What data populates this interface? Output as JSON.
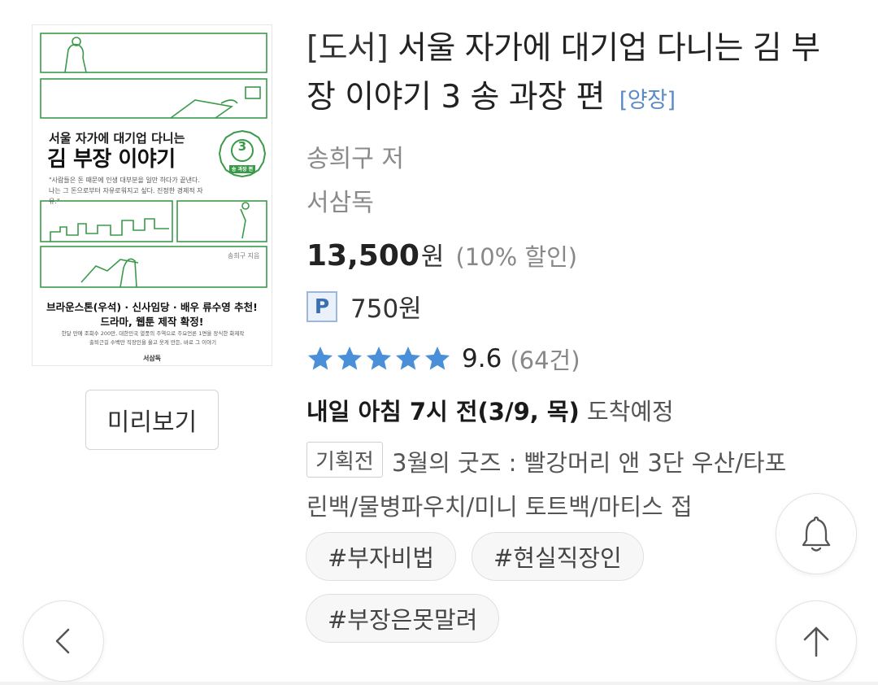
{
  "cover": {
    "subtitle": "서울 자가에 대기업 다니는",
    "title": "김 부장 이야기",
    "volume": "3",
    "volume_label": "송 과장 편",
    "quote_line1": "\"사람들은 돈 때문에 인생 대부분을 일만 하다가 끝낸다.",
    "quote_line2": "나는 그 돈으로부터 자유로워지고 싶다. 진정한 경제적 자유.\"",
    "author": "송희구 지음",
    "promo_line1": "브라운스톤(우석) · 신사임당 · 배우 류수영 추천!",
    "promo_line2": "드라마, 웹툰 제작 확정!",
    "desc_line1": "한달 만에 조회수 200만, 대한민국 열풍의 주역으로 주요언론 1면을 장식한 화제작",
    "desc_line2": "출퇴근길 수백만 직장인을 울고 웃게 만든, 바로 그 이야기",
    "publisher": "서삼독"
  },
  "preview_label": "미리보기",
  "product": {
    "category": "[도서]",
    "title": "서울 자가에 대기업 다니는 김 부장 이야기 3 송 과장 편",
    "binding": "[양장]",
    "author": "송희구 저",
    "publisher": "서삼독",
    "price": "13,500",
    "price_unit": "원",
    "discount": "(10% 할인)",
    "point_badge": "P",
    "point": "750원",
    "rating": 9.6,
    "rating_text": "9.6",
    "stars_filled": 5,
    "review_count": "(64건)",
    "delivery_bold": "내일 아침 7시 전(3/9, 목)",
    "delivery_eta": "도착예정",
    "event_tag": "기획전",
    "event_text": "3월의 굿즈 : 빨강머리 앤 3단 우산/타포린백/물병파우치/미니 토트백/마티스 접",
    "tags": [
      "#부자비법",
      "#현실직장인",
      "#부장은못말려"
    ]
  },
  "colors": {
    "cover_green": "#3a9a4a",
    "star": "#4a90d9",
    "binding_blue": "#5b8bc4"
  },
  "icons": {
    "back": "chevron-left-icon",
    "bell": "bell-icon",
    "top": "arrow-up-icon"
  }
}
